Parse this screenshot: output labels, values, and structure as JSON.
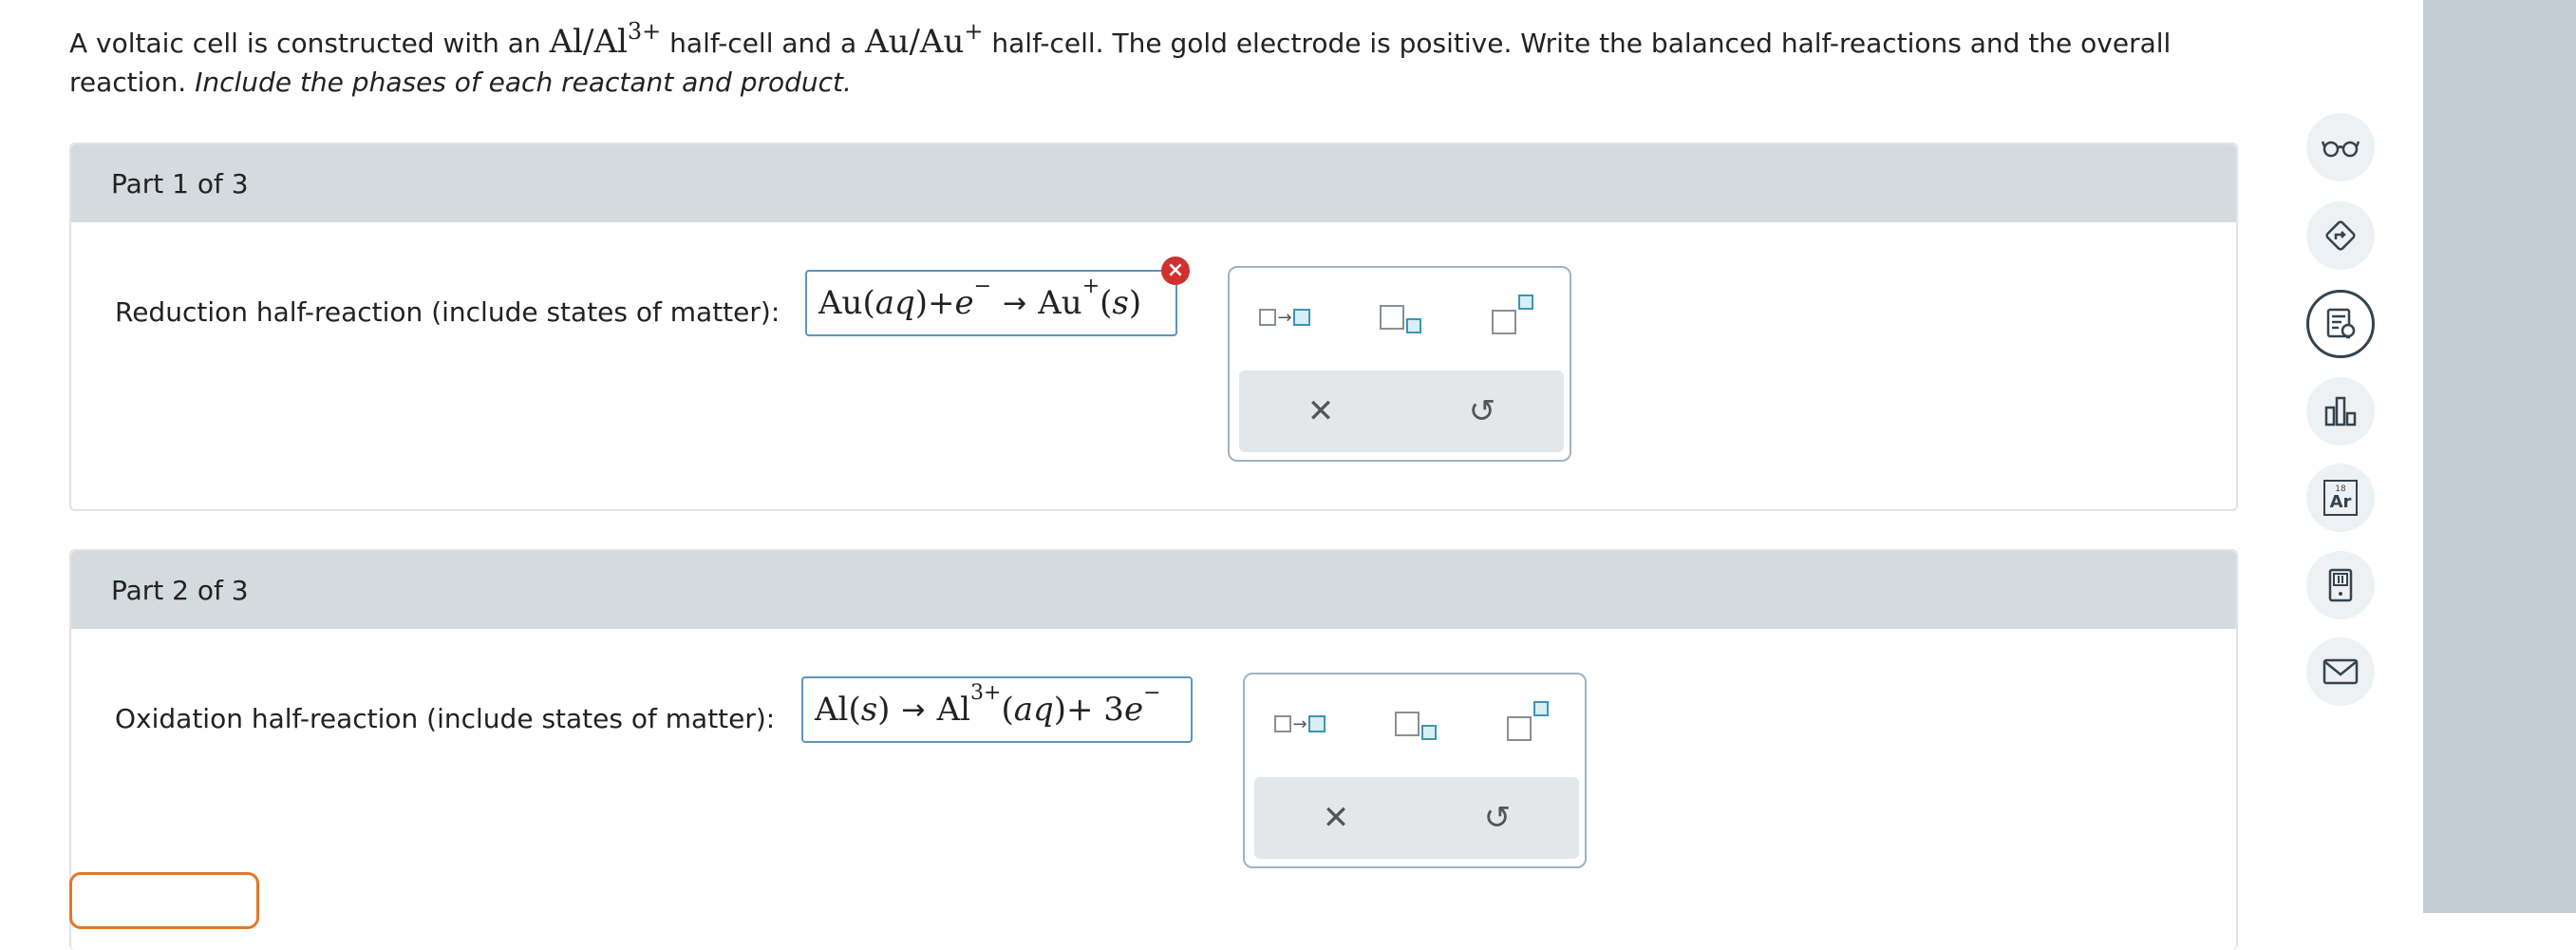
{
  "question": {
    "text_1": "A voltaic cell is constructed with an ",
    "couple_1": "Al/Al",
    "couple_1_charge": "3+",
    "text_2": " half-cell and a ",
    "couple_2": "Au/Au",
    "couple_2_charge": "+",
    "text_3": " half-cell. The gold electrode is positive. Write the balanced half-reactions and the overall",
    "text_4": "reaction. ",
    "instruction": "Include the phases of each reactant and product."
  },
  "parts": [
    {
      "header": "Part 1 of 3",
      "prompt": "Reduction half-reaction (include states of matter):",
      "answer": {
        "t1": "Au",
        "t2": "(",
        "t3": "aq",
        "t4": ")",
        "t5": " + ",
        "t6": "e",
        "t7": "−",
        "arrow": "→",
        "t8": "Au",
        "t9": "+",
        "t10": "(",
        "t11": "s",
        "t12": ")"
      },
      "error_icon": "×"
    },
    {
      "header": "Part 2 of 3",
      "prompt": "Oxidation half-reaction (include states of matter):",
      "answer": {
        "t1": "Al",
        "t2": "(",
        "t3": "s",
        "t4": ")",
        "arrow": "→",
        "t5": "Al",
        "t6": "3+",
        "t7": "(",
        "t8": "aq",
        "t9": ")",
        "t10": " + 3",
        "t11": "e",
        "t12": "−"
      }
    }
  ],
  "palette": {
    "tools": [
      "reaction-arrow-template-icon",
      "subscript-template-icon",
      "superscript-template-icon"
    ],
    "arrow_glyph": "→",
    "clear_glyph": "✕",
    "undo_glyph": "↺"
  },
  "sidebar_icons": [
    "glasses-icon",
    "directions-icon",
    "notes-lightbulb-icon",
    "bar-chart-icon",
    "periodic-table-icon",
    "calculator-icon",
    "mail-icon"
  ],
  "periodic_icon": {
    "number": "18",
    "symbol": "Ar"
  },
  "colors": {
    "accent": "#3f94b6",
    "error": "#d0312d",
    "header_bg": "#d4dbde",
    "strip": "#c4cdd3",
    "orange": "#e0782b"
  }
}
